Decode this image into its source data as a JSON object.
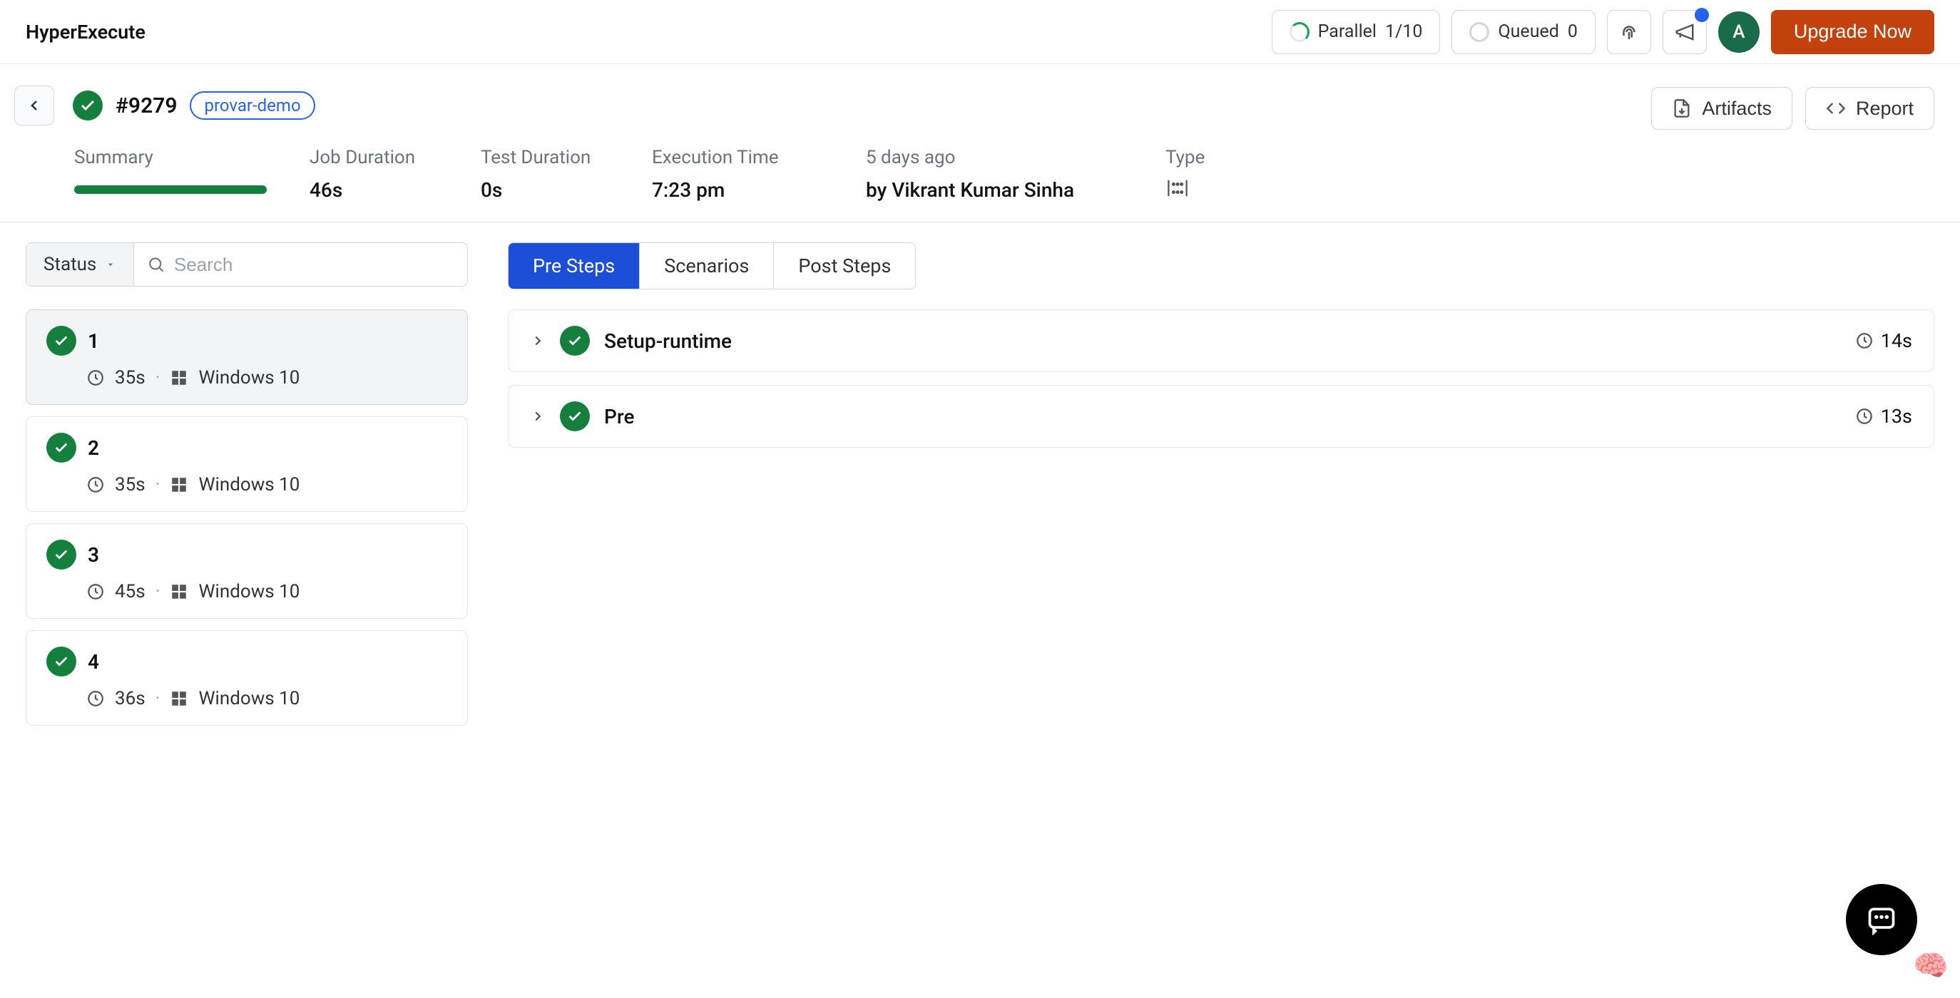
{
  "topbar": {
    "app_title": "HyperExecute",
    "parallel_label": "Parallel",
    "parallel_value": "1/10",
    "queued_label": "Queued",
    "queued_value": "0",
    "avatar_initial": "A",
    "upgrade_label": "Upgrade Now"
  },
  "job": {
    "id": "#9279",
    "tag": "provar-demo",
    "artifacts_label": "Artifacts",
    "report_label": "Report",
    "meta": {
      "summary_label": "Summary",
      "job_duration_label": "Job Duration",
      "job_duration_value": "46s",
      "test_duration_label": "Test Duration",
      "test_duration_value": "0s",
      "exec_time_label": "Execution Time",
      "exec_time_value": "7:23 pm",
      "age_label": "5 days ago",
      "by_value": "by Vikrant Kumar Sinha",
      "type_label": "Type"
    }
  },
  "sidebar": {
    "status_label": "Status",
    "search_placeholder": "Search",
    "tasks": [
      {
        "num": "1",
        "duration": "35s",
        "os": "Windows 10"
      },
      {
        "num": "2",
        "duration": "35s",
        "os": "Windows 10"
      },
      {
        "num": "3",
        "duration": "45s",
        "os": "Windows 10"
      },
      {
        "num": "4",
        "duration": "36s",
        "os": "Windows 10"
      }
    ]
  },
  "tabs": {
    "presteps": "Pre Steps",
    "scenarios": "Scenarios",
    "poststeps": "Post Steps"
  },
  "steps": [
    {
      "name": "Setup-runtime",
      "duration": "14s"
    },
    {
      "name": "Pre",
      "duration": "13s"
    }
  ]
}
